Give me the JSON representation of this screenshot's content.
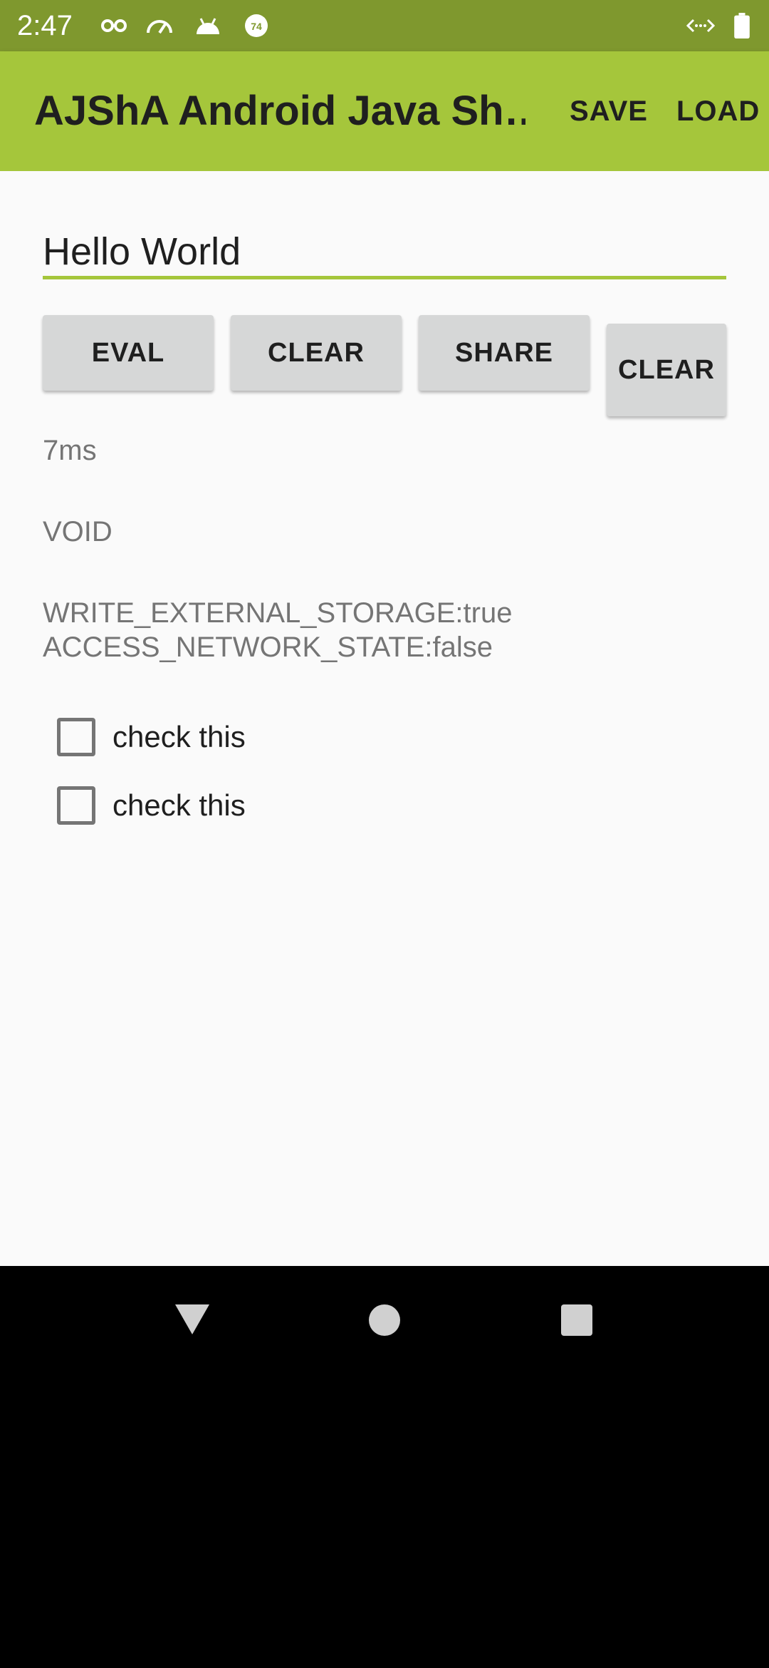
{
  "status_bar": {
    "time": "2:47",
    "icons": [
      "incognito-icon",
      "speedometer-icon",
      "android-icon",
      "notification-badge-icon",
      "data-transfer-icon",
      "battery-icon"
    ],
    "badge_number": "74"
  },
  "app_bar": {
    "title": "AJShA Android Java Sh…",
    "actions": [
      "SAVE",
      "LOAD"
    ]
  },
  "editor": {
    "value": "Hello World"
  },
  "buttons": {
    "eval": "EVAL",
    "clear": "CLEAR",
    "share": "SHARE",
    "clear2": "CLEAR"
  },
  "output": {
    "time": "7ms",
    "result": "VOID",
    "permissions": "WRITE_EXTERNAL_STORAGE:true\nACCESS_NETWORK_STATE:false"
  },
  "checkboxes": [
    {
      "label": "check this",
      "checked": false
    },
    {
      "label": "check this",
      "checked": false
    }
  ],
  "nav_bar": {
    "buttons": [
      "back-icon",
      "home-icon",
      "recents-icon"
    ]
  },
  "colors": {
    "status_bar": "#7f982e",
    "app_bar": "#a5c63b",
    "accent": "#a5c63b",
    "background": "#fafafa",
    "button": "#d6d7d7"
  }
}
